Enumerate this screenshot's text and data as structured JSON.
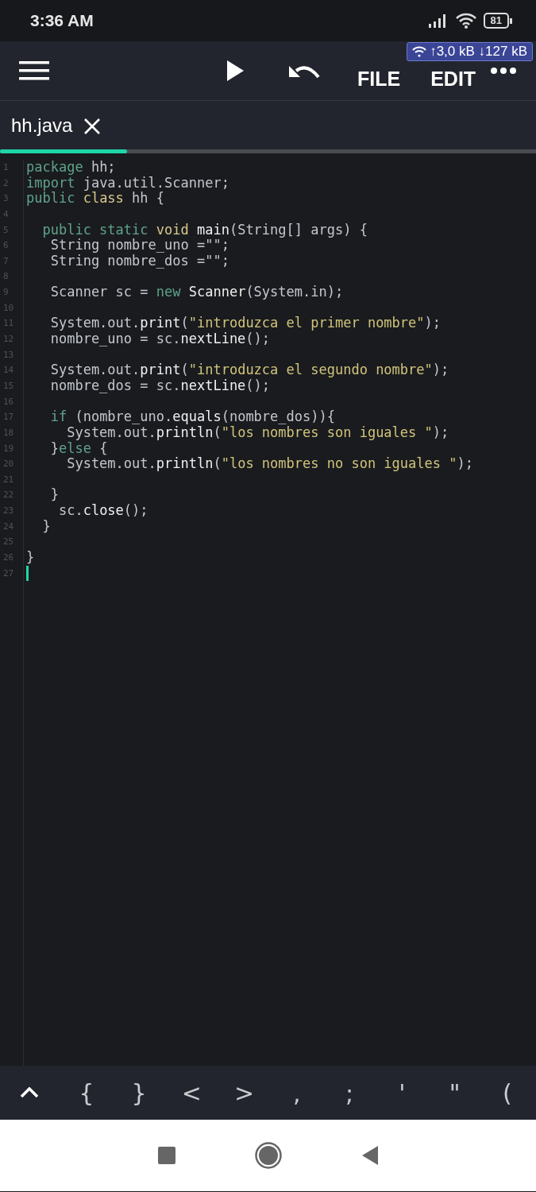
{
  "status_bar": {
    "time": "3:36 AM",
    "battery": "81",
    "net_speed": "↑3,0 kB ↓127 kB"
  },
  "toolbar": {
    "actions": [
      {
        "label": "FILE"
      },
      {
        "label": "EDIT"
      }
    ]
  },
  "tabs": [
    {
      "label": "hh.java",
      "selected": true
    }
  ],
  "editor": {
    "lines": [
      {
        "number": "1",
        "tokens": [
          {
            "kind": "kw",
            "text": "package"
          },
          {
            "kind": "plain",
            "text": " hh;"
          }
        ]
      },
      {
        "number": "2",
        "tokens": [
          {
            "kind": "kw",
            "text": "import"
          },
          {
            "kind": "plain",
            "text": " java.util.Scanner;"
          }
        ]
      },
      {
        "number": "3",
        "tokens": [
          {
            "kind": "kw",
            "text": "public "
          },
          {
            "kind": "type",
            "text": "class"
          },
          {
            "kind": "plain",
            "text": " hh {"
          }
        ]
      },
      {
        "number": "4"
      },
      {
        "number": "5",
        "tokens": [
          {
            "kind": "kw",
            "text": "  public static "
          },
          {
            "kind": "type",
            "text": "void"
          },
          {
            "kind": "fn",
            "text": " main"
          },
          {
            "kind": "plain",
            "text": "(String[] args) {"
          }
        ]
      },
      {
        "number": "6",
        "tokens": [
          {
            "kind": "plain",
            "text": "   String nombre_uno =\"\";"
          }
        ]
      },
      {
        "number": "7",
        "tokens": [
          {
            "kind": "plain",
            "text": "   String nombre_dos =\"\";"
          }
        ]
      },
      {
        "number": "8"
      },
      {
        "number": "9",
        "tokens": [
          {
            "kind": "plain",
            "text": "   Scanner sc = "
          },
          {
            "kind": "kw",
            "text": "new"
          },
          {
            "kind": "fn",
            "text": " Scanner"
          },
          {
            "kind": "plain",
            "text": "(System.in);"
          }
        ]
      },
      {
        "number": "10"
      },
      {
        "number": "11",
        "tokens": [
          {
            "kind": "plain",
            "text": "   System.out."
          },
          {
            "kind": "fn",
            "text": "print"
          },
          {
            "kind": "plain",
            "text": "("
          },
          {
            "kind": "str",
            "text": "\"introduzca el primer nombre\""
          },
          {
            "kind": "plain",
            "text": ");"
          }
        ]
      },
      {
        "number": "12",
        "tokens": [
          {
            "kind": "plain",
            "text": "   nombre_uno = sc."
          },
          {
            "kind": "fn",
            "text": "nextLine"
          },
          {
            "kind": "plain",
            "text": "();"
          }
        ]
      },
      {
        "number": "13"
      },
      {
        "number": "14",
        "tokens": [
          {
            "kind": "plain",
            "text": "   System.out."
          },
          {
            "kind": "fn",
            "text": "print"
          },
          {
            "kind": "plain",
            "text": "("
          },
          {
            "kind": "str",
            "text": "\"introduzca el segundo nombre\""
          },
          {
            "kind": "plain",
            "text": ");"
          }
        ]
      },
      {
        "number": "15",
        "tokens": [
          {
            "kind": "plain",
            "text": "   nombre_dos = sc."
          },
          {
            "kind": "fn",
            "text": "nextLine"
          },
          {
            "kind": "plain",
            "text": "();"
          }
        ]
      },
      {
        "number": "16"
      },
      {
        "number": "17",
        "tokens": [
          {
            "kind": "kw",
            "text": "   if"
          },
          {
            "kind": "plain",
            "text": " (nombre_uno."
          },
          {
            "kind": "fn",
            "text": "equals"
          },
          {
            "kind": "plain",
            "text": "(nombre_dos)){"
          }
        ]
      },
      {
        "number": "18",
        "tokens": [
          {
            "kind": "plain",
            "text": "     System.out."
          },
          {
            "kind": "fn",
            "text": "println"
          },
          {
            "kind": "plain",
            "text": "("
          },
          {
            "kind": "str",
            "text": "\"los nombres son iguales \""
          },
          {
            "kind": "plain",
            "text": ");"
          }
        ]
      },
      {
        "number": "19",
        "tokens": [
          {
            "kind": "plain",
            "text": "   }"
          },
          {
            "kind": "kw",
            "text": "else"
          },
          {
            "kind": "plain",
            "text": " {"
          }
        ]
      },
      {
        "number": "20",
        "tokens": [
          {
            "kind": "plain",
            "text": "     System.out."
          },
          {
            "kind": "fn",
            "text": "println"
          },
          {
            "kind": "plain",
            "text": "("
          },
          {
            "kind": "str",
            "text": "\"los nombres no son iguales \""
          },
          {
            "kind": "plain",
            "text": ");"
          }
        ]
      },
      {
        "number": "21"
      },
      {
        "number": "22",
        "tokens": [
          {
            "kind": "plain",
            "text": "   }"
          }
        ]
      },
      {
        "number": "23",
        "tokens": [
          {
            "kind": "plain",
            "text": "    sc."
          },
          {
            "kind": "fn",
            "text": "close"
          },
          {
            "kind": "plain",
            "text": "();"
          }
        ]
      },
      {
        "number": "24",
        "tokens": [
          {
            "kind": "plain",
            "text": "  }"
          }
        ]
      },
      {
        "number": "25"
      },
      {
        "number": "26",
        "tokens": [
          {
            "kind": "plain",
            "text": "}"
          }
        ]
      },
      {
        "number": "27",
        "cursor": true
      }
    ]
  },
  "extra_keys": [
    "{",
    "}",
    "<",
    ">",
    ",",
    ";",
    "'",
    "\"",
    "("
  ]
}
